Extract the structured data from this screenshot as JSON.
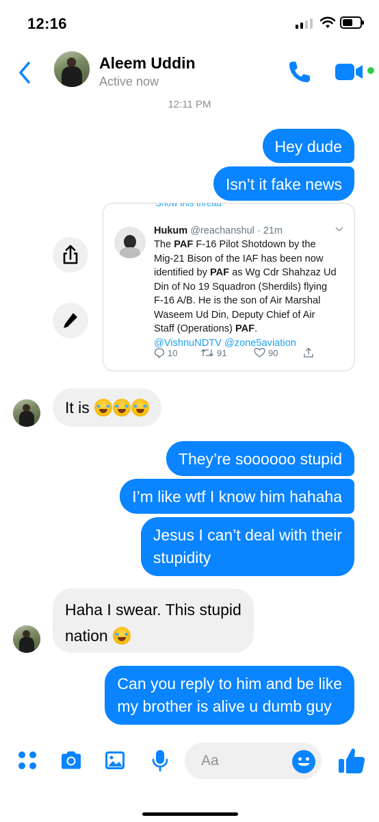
{
  "status_bar": {
    "time": "12:16",
    "signal_bars_active": 2,
    "signal_bars_total": 4,
    "battery_level": 0.6
  },
  "header": {
    "contact_name": "Aleem Uddin",
    "contact_status": "Active now"
  },
  "timestamp": "12:11 PM",
  "messages": {
    "out_1": "Hey dude",
    "out_2": "Isn’t it fake news",
    "in_1": "It is",
    "out_3": "They’re soooooo stupid",
    "out_4": "I’m like wtf I know him hahaha",
    "out_5_line1": "Jesus I can’t deal with their",
    "out_5_line2": "stupidity",
    "in_2_line1": "Haha I swear. This stupid",
    "in_2_line2": "nation",
    "out_6_line1": "Can you reply to him and be like",
    "out_6_line2": "my brother is alive u dumb guy"
  },
  "tweet": {
    "show_thread": "Show this thread",
    "name": "Hukum",
    "handle_time": "@reachanshul · 21m",
    "lines": [
      [
        "The ",
        "PAF",
        " F-16 Pilot Shotdown by the"
      ],
      [
        "Mig-21 Bison of the IAF has been now",
        "",
        ""
      ],
      [
        "identified by ",
        "PAF",
        " as Wg Cdr Shahzaz Ud"
      ],
      [
        "Din of No 19 Squadron (Sherdils) flying",
        "",
        ""
      ],
      [
        "F-16 A/B. He is the son of Air Marshal",
        "",
        ""
      ],
      [
        "Waseem Ud Din, Deputy Chief of Air",
        "",
        ""
      ],
      [
        "Staff (Operations) ",
        "PAF",
        "."
      ]
    ],
    "mentions": "@VishnuNDTV @zone5aviation",
    "replies": "10",
    "retweets": "91",
    "likes": "90"
  },
  "composer": {
    "placeholder": "Aa"
  },
  "colors": {
    "accent": "#0a84ff",
    "incoming_bubble": "#f0f0f0",
    "online": "#31cc46",
    "twitter_blue": "#1da1f2"
  },
  "icons": [
    "back-chevron-icon",
    "phone-icon",
    "video-camera-icon",
    "share-icon",
    "pencil-icon",
    "apps-grid-icon",
    "camera-icon",
    "gallery-icon",
    "microphone-icon",
    "smiley-icon",
    "thumbs-up-icon",
    "reply-icon",
    "retweet-icon",
    "heart-icon",
    "tweet-share-icon"
  ]
}
